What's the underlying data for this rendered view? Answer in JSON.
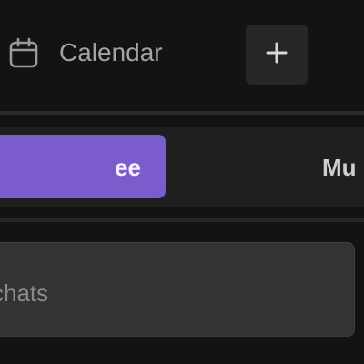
{
  "header": {
    "calendar_label": "Calendar",
    "calendar_icon": "calendar-icon",
    "add_icon": "plus-icon"
  },
  "tabs": {
    "active_label": "ee",
    "inactive_label": "Mu"
  },
  "search": {
    "placeholder": "chats"
  },
  "colors": {
    "background": "#131313",
    "accent": "#7b5ccc",
    "button_bg": "#262626",
    "input_bg": "#333333"
  }
}
